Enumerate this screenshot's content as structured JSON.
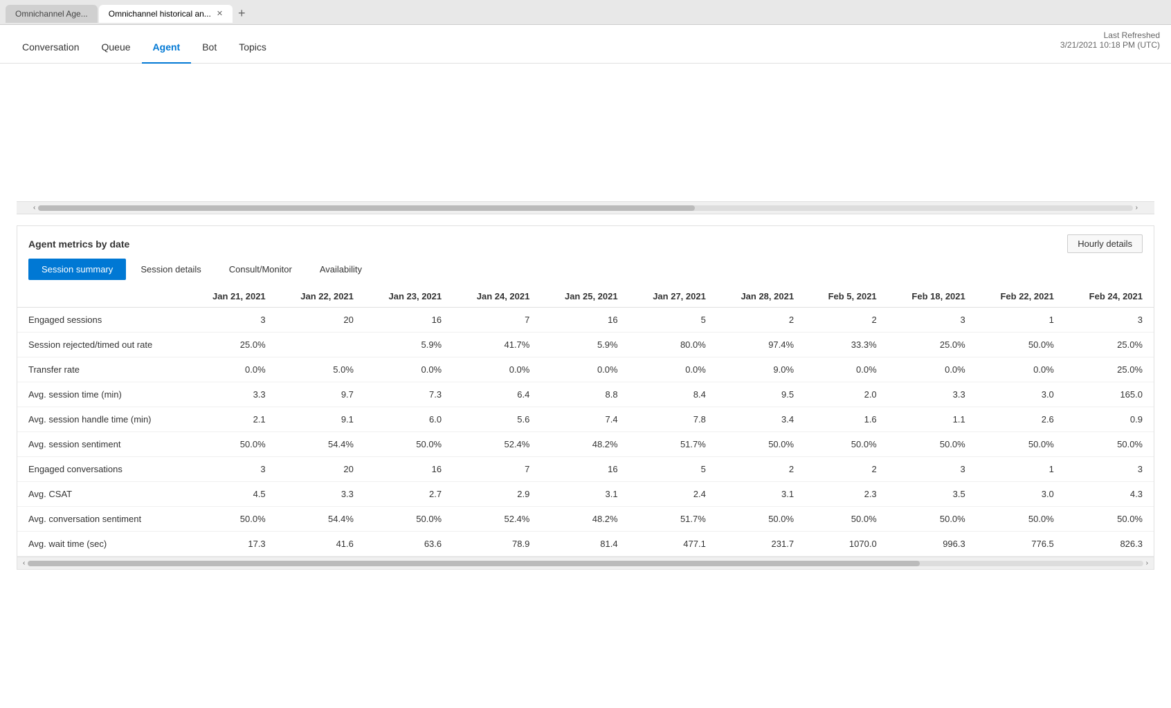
{
  "browser": {
    "tabs": [
      {
        "label": "Omnichannel Age...",
        "active": false
      },
      {
        "label": "Omnichannel historical an...",
        "active": true
      }
    ],
    "new_tab_label": "+"
  },
  "nav": {
    "items": [
      {
        "label": "Conversation",
        "active": false
      },
      {
        "label": "Queue",
        "active": false
      },
      {
        "label": "Agent",
        "active": true
      },
      {
        "label": "Bot",
        "active": false
      },
      {
        "label": "Topics",
        "active": false
      }
    ],
    "last_refreshed_label": "Last Refreshed",
    "last_refreshed_value": "3/21/2021 10:18 PM (UTC)"
  },
  "metrics": {
    "title": "Agent metrics by date",
    "hourly_button_label": "Hourly details",
    "sub_tabs": [
      {
        "label": "Session summary",
        "active": true
      },
      {
        "label": "Session details",
        "active": false
      },
      {
        "label": "Consult/Monitor",
        "active": false
      },
      {
        "label": "Availability",
        "active": false
      }
    ],
    "table": {
      "columns": [
        "",
        "Jan 21, 2021",
        "Jan 22, 2021",
        "Jan 23, 2021",
        "Jan 24, 2021",
        "Jan 25, 2021",
        "Jan 27, 2021",
        "Jan 28, 2021",
        "Feb 5, 2021",
        "Feb 18, 2021",
        "Feb 22, 2021",
        "Feb 24, 2021"
      ],
      "rows": [
        {
          "label": "Engaged sessions",
          "values": [
            "3",
            "20",
            "16",
            "7",
            "16",
            "5",
            "2",
            "2",
            "3",
            "1",
            "3"
          ]
        },
        {
          "label": "Session rejected/timed out rate",
          "values": [
            "25.0%",
            "",
            "5.9%",
            "41.7%",
            "5.9%",
            "80.0%",
            "97.4%",
            "33.3%",
            "25.0%",
            "50.0%",
            "25.0%"
          ]
        },
        {
          "label": "Transfer rate",
          "values": [
            "0.0%",
            "5.0%",
            "0.0%",
            "0.0%",
            "0.0%",
            "0.0%",
            "9.0%",
            "0.0%",
            "0.0%",
            "0.0%",
            "25.0%"
          ]
        },
        {
          "label": "Avg. session time (min)",
          "values": [
            "3.3",
            "9.7",
            "7.3",
            "6.4",
            "8.8",
            "8.4",
            "9.5",
            "2.0",
            "3.3",
            "3.0",
            "165.0"
          ]
        },
        {
          "label": "Avg. session handle time (min)",
          "values": [
            "2.1",
            "9.1",
            "6.0",
            "5.6",
            "7.4",
            "7.8",
            "3.4",
            "1.6",
            "1.1",
            "2.6",
            "0.9"
          ]
        },
        {
          "label": "Avg. session sentiment",
          "values": [
            "50.0%",
            "54.4%",
            "50.0%",
            "52.4%",
            "48.2%",
            "51.7%",
            "50.0%",
            "50.0%",
            "50.0%",
            "50.0%",
            "50.0%"
          ]
        },
        {
          "label": "Engaged conversations",
          "values": [
            "3",
            "20",
            "16",
            "7",
            "16",
            "5",
            "2",
            "2",
            "3",
            "1",
            "3"
          ]
        },
        {
          "label": "Avg. CSAT",
          "values": [
            "4.5",
            "3.3",
            "2.7",
            "2.9",
            "3.1",
            "2.4",
            "3.1",
            "2.3",
            "3.5",
            "3.0",
            "4.3"
          ]
        },
        {
          "label": "Avg. conversation sentiment",
          "values": [
            "50.0%",
            "54.4%",
            "50.0%",
            "52.4%",
            "48.2%",
            "51.7%",
            "50.0%",
            "50.0%",
            "50.0%",
            "50.0%",
            "50.0%"
          ]
        },
        {
          "label": "Avg. wait time (sec)",
          "values": [
            "17.3",
            "41.6",
            "63.6",
            "78.9",
            "81.4",
            "477.1",
            "231.7",
            "1070.0",
            "996.3",
            "776.5",
            "826.3"
          ]
        }
      ]
    }
  }
}
